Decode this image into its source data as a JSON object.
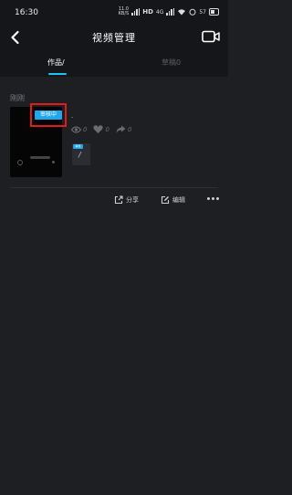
{
  "status_bar": {
    "time": "16:30",
    "net_speed_value": "11.0",
    "net_speed_unit": "KB/S",
    "hd": "HD",
    "signal_label": "4G",
    "battery_label": "57"
  },
  "header": {
    "title": "视频管理"
  },
  "tabs": [
    {
      "label": "作品/"
    },
    {
      "label": "草稿0"
    }
  ],
  "section": {
    "label": "刚刚"
  },
  "post": {
    "tag": "审核中",
    "description": ".",
    "views": "0",
    "likes": "0",
    "shares": "0",
    "mini_tag": "审核",
    "mini_text": "/"
  },
  "actions": {
    "share_label": "分享",
    "edit_label": "编辑"
  },
  "colors": {
    "accent": "#20c4f4",
    "tag_blue": "#1fa6ec",
    "highlight_red": "#e11b1b",
    "background": "#1e1f23"
  }
}
